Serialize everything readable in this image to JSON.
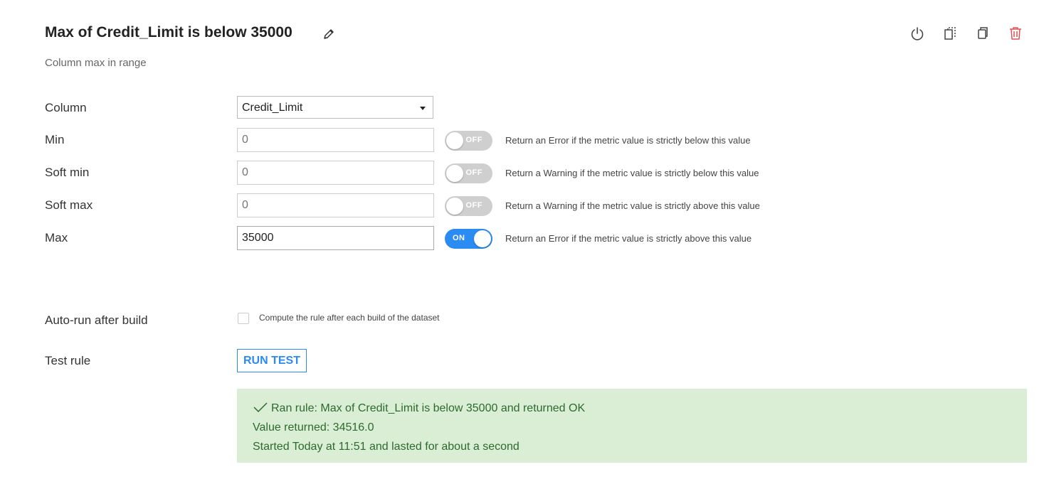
{
  "header": {
    "title": "Max of Credit_Limit is below 35000",
    "subtitle": "Column max in range",
    "icons": [
      "pencil-icon",
      "power-icon",
      "copy-dashed-icon",
      "duplicate-icon",
      "trash-icon"
    ],
    "danger_color": "#e05252"
  },
  "form": {
    "column": {
      "label": "Column",
      "value": "Credit_Limit"
    },
    "min": {
      "label": "Min",
      "placeholder": "0",
      "value": "",
      "toggle": "OFF",
      "enabled": false,
      "hint": "Return an Error if the metric value is strictly below this value"
    },
    "soft_min": {
      "label": "Soft min",
      "placeholder": "0",
      "value": "",
      "toggle": "OFF",
      "enabled": false,
      "hint": "Return a Warning if the metric value is strictly below this value"
    },
    "soft_max": {
      "label": "Soft max",
      "placeholder": "0",
      "value": "",
      "toggle": "OFF",
      "enabled": false,
      "hint": "Return a Warning if the metric value is strictly above this value"
    },
    "max": {
      "label": "Max",
      "placeholder": "",
      "value": "35000",
      "toggle": "ON",
      "enabled": true,
      "hint": "Return an Error if the metric value is strictly above this value"
    },
    "auto_run": {
      "label": "Auto-run after build",
      "checked": false,
      "checkbox_label": "Compute the rule after each build of the dataset"
    },
    "test": {
      "label": "Test rule",
      "button": "RUN TEST"
    }
  },
  "result": {
    "status_icon": "check-icon",
    "line1": "Ran rule: Max of Credit_Limit is below 35000 and returned OK",
    "line2": "Value returned: 34516.0",
    "line3": "Started Today at 11:51 and lasted for about a second",
    "background": "#d9eed5",
    "text_color": "#2d6a2d"
  },
  "colors": {
    "accent": "#2a8bf2",
    "toggle_off": "#cfcfcf"
  }
}
